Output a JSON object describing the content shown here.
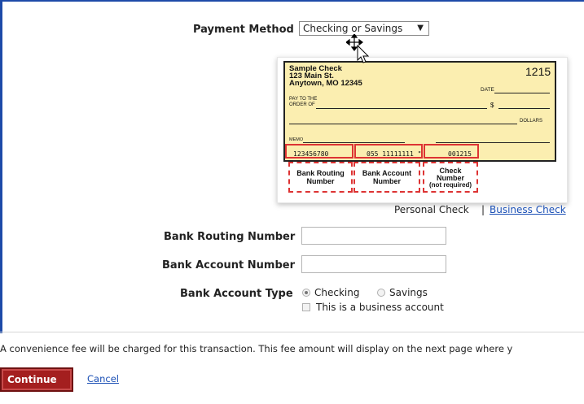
{
  "payment": {
    "label": "Payment Method",
    "selected": "Checking or Savings"
  },
  "check_sample": {
    "name": "Sample Check",
    "address1": "123 Main St.",
    "address2": "Anytown, MO 12345",
    "number": "1215",
    "date_label": "DATE",
    "pay_to_1": "PAY TO THE",
    "pay_to_2": "ORDER OF",
    "dollar_sign": "$",
    "dollars": "DOLLARS",
    "memo": "MEMO",
    "micr_routing": "123456780",
    "micr_account": "055 11111111 \"",
    "micr_check": "001215",
    "cap_routing_1": "Bank Routing",
    "cap_routing_2": "Number",
    "cap_account_1": "Bank Account",
    "cap_account_2": "Number",
    "cap_check_1": "Check",
    "cap_check_2": "Number",
    "cap_check_3": "(not required)"
  },
  "check_type": {
    "personal": "Personal Check",
    "separator": "|",
    "business": "Business Check"
  },
  "fields": {
    "routing_label": "Bank Routing Number",
    "routing_value": "",
    "account_label": "Bank Account Number",
    "account_value": "",
    "type_label": "Bank Account Type",
    "checking": "Checking",
    "savings": "Savings",
    "business_account": "This is a business account"
  },
  "notice": "A convenience fee will be charged for this transaction. This fee amount will display on the next page where y",
  "actions": {
    "continue": "Continue",
    "cancel": "Cancel"
  }
}
